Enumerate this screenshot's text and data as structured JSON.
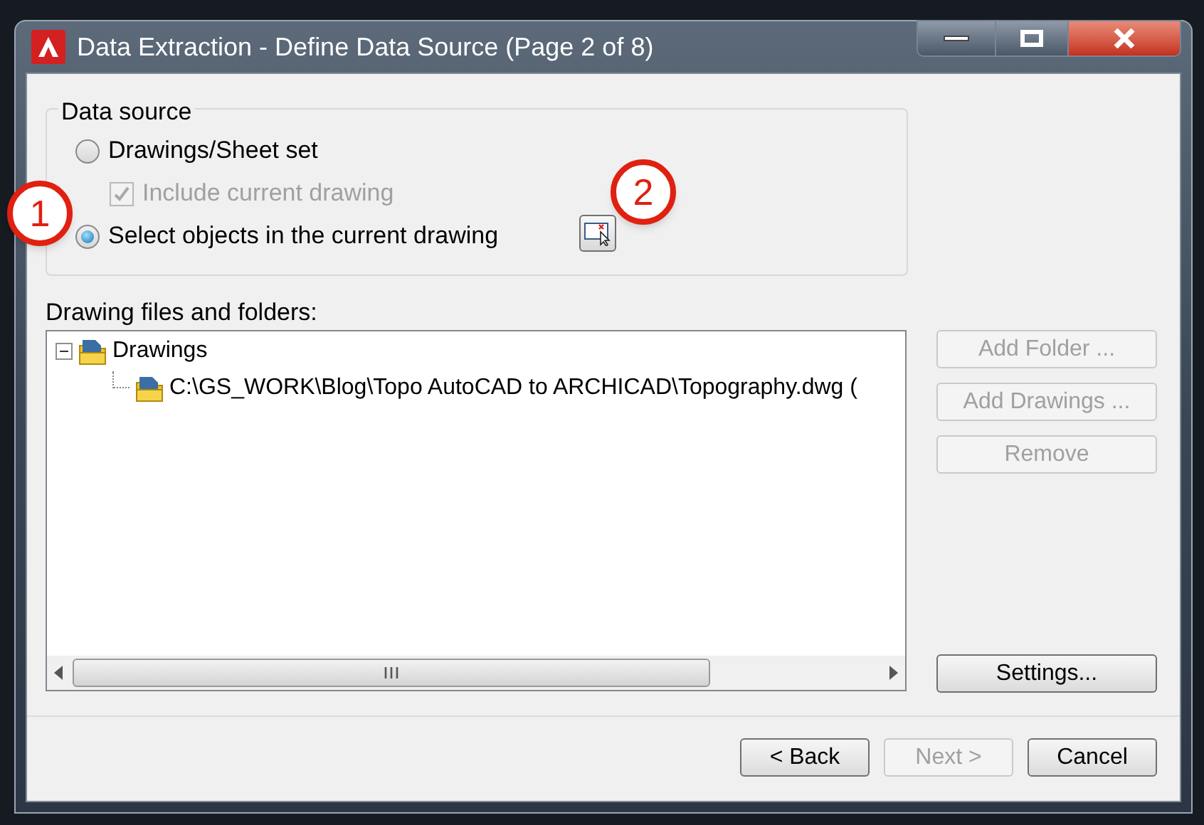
{
  "window": {
    "title": "Data Extraction - Define Data Source (Page 2 of 8)"
  },
  "data_source": {
    "legend": "Data source",
    "options": [
      {
        "kind": "radio",
        "label": "Drawings/Sheet set",
        "selected": false
      },
      {
        "kind": "checkbox",
        "label": "Include current drawing",
        "checked": true,
        "disabled": true
      },
      {
        "kind": "radio",
        "label": "Select objects in the current drawing",
        "selected": true
      }
    ]
  },
  "callouts": [
    "1",
    "2"
  ],
  "files": {
    "label": "Drawing files and folders:",
    "tree": [
      {
        "label": "Drawings",
        "expanded": true,
        "children": [
          {
            "label": "C:\\GS_WORK\\Blog\\Topo AutoCAD to ARCHICAD\\Topography.dwg ("
          }
        ]
      }
    ]
  },
  "side_buttons": [
    {
      "label": "Add Folder ...",
      "disabled": true
    },
    {
      "label": "Add Drawings ...",
      "disabled": true
    },
    {
      "label": "Remove",
      "disabled": true
    }
  ],
  "settings_button": {
    "label": "Settings...",
    "disabled": false
  },
  "footer_buttons": [
    {
      "label": "< Back",
      "disabled": false
    },
    {
      "label": "Next >",
      "disabled": true
    },
    {
      "label": "Cancel",
      "disabled": false
    }
  ]
}
